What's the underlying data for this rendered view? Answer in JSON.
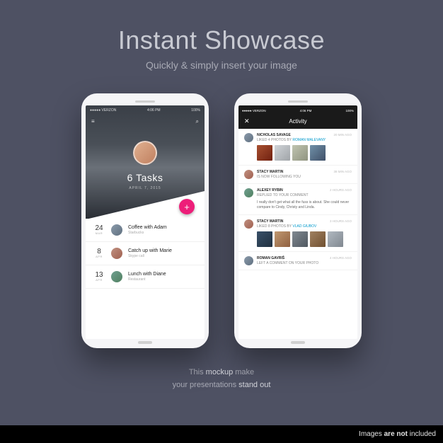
{
  "hero": {
    "title": "Instant Showcase",
    "subtitle": "Quickly & simply insert your image"
  },
  "phone1": {
    "status": {
      "carrier": "●●●●● VERZON",
      "time": "4:06 PM",
      "battery": "100%"
    },
    "nav": {
      "menu": "≡",
      "search": "⌕"
    },
    "tasks_label": "6 Tasks",
    "date": "APRIL 7, 2015",
    "fab": "+",
    "items": [
      {
        "day": "24",
        "month": "MAR",
        "title": "Coffee with Adam",
        "sub": "Starbucks"
      },
      {
        "day": "8",
        "month": "APR",
        "title": "Catch up with Marie",
        "sub": "Skype call"
      },
      {
        "day": "13",
        "month": "APR",
        "title": "Lunch with Diane",
        "sub": "Restaurant"
      }
    ]
  },
  "phone2": {
    "status": {
      "carrier": "●●●●● VERZON",
      "time": "4:06 PM",
      "battery": "100%"
    },
    "nav": {
      "close": "✕",
      "title": "Activity"
    },
    "feed": [
      {
        "name": "NICHOLAS SAVAGE",
        "action": "LIKED 4 PHOTOS BY",
        "link": "ROMAN MALEVANY",
        "time": "20 MIN AGO",
        "thumbs": 4,
        "body": ""
      },
      {
        "name": "STACY MARTIN",
        "action": "IS NOW FOLLOWING YOU",
        "link": "",
        "time": "38 MIN AGO",
        "thumbs": 0,
        "body": ""
      },
      {
        "name": "ALEXEY RYBIN",
        "action": "REPLIED TO YOUR COMMENT",
        "link": "",
        "time": "2 HOURS AGO",
        "thumbs": 0,
        "body": "I really don't get what all the fuss is about. She could never compare to Cindy, Christy and Linda."
      },
      {
        "name": "STACY MARTIN",
        "action": "LIKED 8 PHOTOS BY",
        "link": "VLAD GIUBOV",
        "time": "3 HOURS AGO",
        "thumbs": 5,
        "body": ""
      },
      {
        "name": "ROMAN GAVRIŠ",
        "action": "LEFT A COMMENT ON YOUR PHOTO",
        "link": "",
        "time": "4 HOURS AGO",
        "thumbs": 0,
        "body": ""
      }
    ]
  },
  "footer": {
    "line1_a": "This ",
    "line1_em": "mockup",
    "line1_b": " make",
    "line2_a": "your presentations  ",
    "line2_em": "stand out"
  },
  "bottom": {
    "text_a": "Images ",
    "text_b": "are not",
    "text_c": " included"
  }
}
